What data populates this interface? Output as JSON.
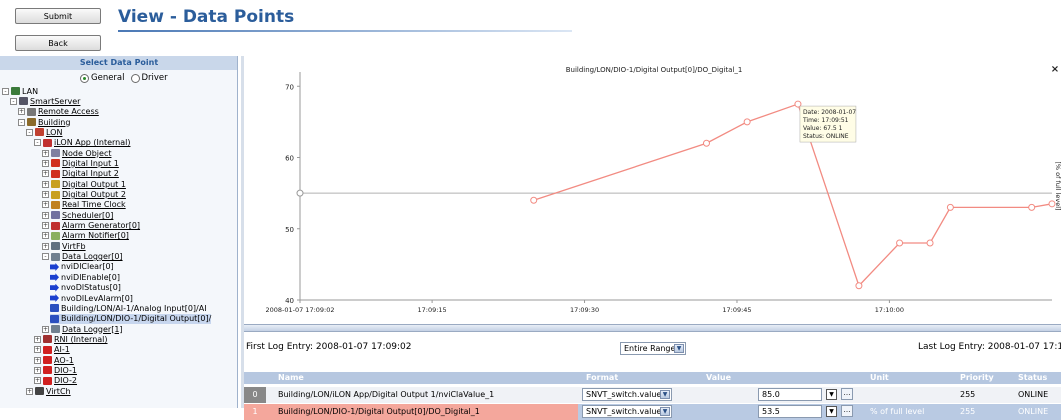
{
  "toolbar": {
    "submit_label": "Submit",
    "back_label": "Back"
  },
  "page": {
    "title": "View - Data Points"
  },
  "left_panel": {
    "header": "Select Data Point",
    "radio_general": "General",
    "radio_driver": "Driver",
    "tree": [
      {
        "label": "LAN",
        "level": 0,
        "toggle": "-",
        "icon": "network-icon",
        "underline": false
      },
      {
        "label": "SmartServer",
        "level": 1,
        "toggle": "-",
        "icon": "server-icon",
        "underline": true
      },
      {
        "label": "Remote Access",
        "level": 2,
        "toggle": "+",
        "icon": "remote-icon",
        "underline": true
      },
      {
        "label": "Building",
        "level": 2,
        "toggle": "-",
        "icon": "building-icon",
        "underline": true
      },
      {
        "label": "LON",
        "level": 3,
        "toggle": "-",
        "icon": "lon-icon",
        "underline": true
      },
      {
        "label": "iLON App (Internal)",
        "level": 4,
        "toggle": "-",
        "icon": "app-icon",
        "underline": true
      },
      {
        "label": "Node Object",
        "level": 5,
        "toggle": "+",
        "icon": "node-icon",
        "underline": true
      },
      {
        "label": "Digital Input 1",
        "level": 5,
        "toggle": "+",
        "icon": "input-icon",
        "underline": true
      },
      {
        "label": "Digital Input 2",
        "level": 5,
        "toggle": "+",
        "icon": "input-icon",
        "underline": true
      },
      {
        "label": "Digital Output 1",
        "level": 5,
        "toggle": "+",
        "icon": "output-icon",
        "underline": true
      },
      {
        "label": "Digital Output 2",
        "level": 5,
        "toggle": "+",
        "icon": "output-icon",
        "underline": true
      },
      {
        "label": "Real Time Clock",
        "level": 5,
        "toggle": "+",
        "icon": "clock-icon",
        "underline": true
      },
      {
        "label": "Scheduler[0]",
        "level": 5,
        "toggle": "+",
        "icon": "scheduler-icon",
        "underline": true
      },
      {
        "label": "Alarm Generator[0]",
        "level": 5,
        "toggle": "+",
        "icon": "alarm-icon",
        "underline": true
      },
      {
        "label": "Alarm Notifier[0]",
        "level": 5,
        "toggle": "+",
        "icon": "notifier-icon",
        "underline": true
      },
      {
        "label": "VirtFb",
        "level": 5,
        "toggle": "+",
        "icon": "virtual-icon",
        "underline": true
      },
      {
        "label": "Data Logger[0]",
        "level": 5,
        "toggle": "-",
        "icon": "logger-icon",
        "underline": true
      },
      {
        "label": "nviDlClear[0]",
        "level": 6,
        "toggle": "",
        "icon": "input-arrow-icon",
        "underline": false
      },
      {
        "label": "nviDlEnable[0]",
        "level": 6,
        "toggle": "",
        "icon": "input-arrow-icon",
        "underline": false
      },
      {
        "label": "nvoDlStatus[0]",
        "level": 6,
        "toggle": "",
        "icon": "output-arrow-icon",
        "underline": false
      },
      {
        "label": "nvoDlLevAlarm[0]",
        "level": 6,
        "toggle": "",
        "icon": "output-arrow-icon",
        "underline": false
      },
      {
        "label": "Building/LON/AI-1/Analog Input[0]/AI",
        "level": 6,
        "toggle": "",
        "icon": "link-icon",
        "underline": false
      },
      {
        "label": "Building/LON/DIO-1/Digital Output[0]/",
        "level": 6,
        "toggle": "",
        "icon": "link-icon",
        "underline": false,
        "selected": true
      },
      {
        "label": "Data Logger[1]",
        "level": 5,
        "toggle": "+",
        "icon": "logger-icon",
        "underline": true
      },
      {
        "label": "RNI (Internal)",
        "level": 4,
        "toggle": "+",
        "icon": "rni-icon",
        "underline": true
      },
      {
        "label": "AI-1",
        "level": 4,
        "toggle": "+",
        "icon": "device-icon",
        "underline": true
      },
      {
        "label": "AO-1",
        "level": 4,
        "toggle": "+",
        "icon": "device-icon",
        "underline": true
      },
      {
        "label": "DIO-1",
        "level": 4,
        "toggle": "+",
        "icon": "device-icon",
        "underline": true
      },
      {
        "label": "DIO-2",
        "level": 4,
        "toggle": "+",
        "icon": "device-icon",
        "underline": true
      },
      {
        "label": "VirtCh",
        "level": 3,
        "toggle": "+",
        "icon": "channel-icon",
        "underline": true
      }
    ]
  },
  "chart_data": {
    "type": "line",
    "title": "Building/LON/DIO-1/Digital Output[0]/DO_Digital_1",
    "ylabel": "[% of full level]",
    "ylim": [
      40,
      72
    ],
    "xlim": [
      "2008-01-07 17:09:02",
      "2008-01-07 17:10:16"
    ],
    "x_ticks": [
      "2008-01-07 17:09:02",
      "17:09:15",
      "17:09:30",
      "17:09:45",
      "17:10:00"
    ],
    "y_ticks": [
      40,
      50,
      60,
      70
    ],
    "reference_line": 55,
    "series": [
      {
        "color": "#f28b82",
        "points": [
          [
            "17:09:25",
            54
          ],
          [
            "17:09:42",
            62
          ],
          [
            "17:09:46",
            65
          ],
          [
            "17:09:51",
            67.5
          ],
          [
            "17:09:57",
            42
          ],
          [
            "17:10:01",
            48
          ],
          [
            "17:10:04",
            48
          ],
          [
            "17:10:06",
            53
          ],
          [
            "17:10:14",
            53
          ],
          [
            "17:10:16",
            53.5
          ]
        ]
      }
    ],
    "tooltip": {
      "date": "Date: 2008-01-07",
      "time": "Time: 17:09:51",
      "value": "Value: 67.5 1",
      "status": "Status: ONLINE"
    }
  },
  "log_info": {
    "first_entry": "First Log Entry: 2008-01-07 17:09:02",
    "range_select": "Entire Range",
    "last_entry": "Last Log Entry: 2008-01-07 17:10:1"
  },
  "table": {
    "headers": [
      "Name",
      "Format",
      "Value",
      "Unit",
      "Priority",
      "Status"
    ],
    "rows": [
      {
        "index": "0",
        "name": "Building/LON/iLON App/Digital Output 1/nviClaValue_1",
        "format": "SNVT_switch.value",
        "value": "85.0",
        "unit": "",
        "priority": "255",
        "status": "ONLINE"
      },
      {
        "index": "1",
        "name": "Building/LON/DIO-1/Digital Output[0]/DO_Digital_1",
        "format": "SNVT_switch.value",
        "value": "53.5",
        "unit": "% of full level",
        "priority": "255",
        "status": "ONLINE"
      }
    ]
  },
  "colors": {
    "title_blue": "#2b5d9b",
    "series_pink": "#f28b82",
    "selected_row": "#f4a79c",
    "header_blue": "#b6c7e0"
  }
}
